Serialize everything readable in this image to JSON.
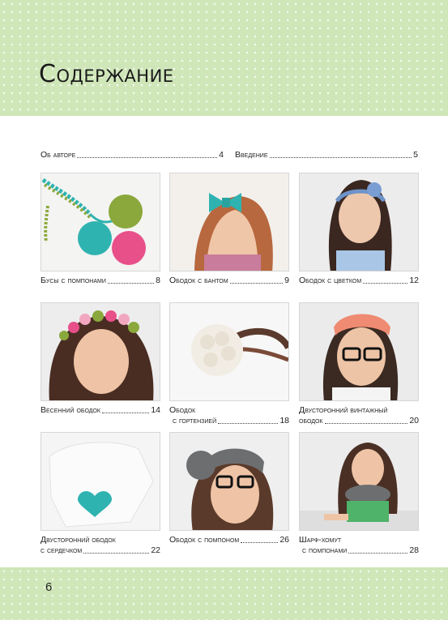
{
  "header": {
    "title": "Содержание"
  },
  "footer": {
    "page_number": "6"
  },
  "intro_entries": [
    {
      "label": "Об авторе",
      "page": "4"
    },
    {
      "label": "Введение",
      "page": "5"
    }
  ],
  "projects": [
    {
      "lines": [
        "Бусы с помпонами"
      ],
      "page": "8",
      "image": "pompom-necklace-photo"
    },
    {
      "lines": [
        "Ободок с бантом"
      ],
      "page": "9",
      "image": "bow-headband-photo"
    },
    {
      "lines": [
        "Ободок с цветком"
      ],
      "page": "12",
      "image": "flower-headband-photo"
    },
    {
      "lines": [
        "Весенний ободок"
      ],
      "page": "14",
      "image": "spring-wreath-headband-photo"
    },
    {
      "lines": [
        "Ободок",
        "с гортензией"
      ],
      "page": "18",
      "image": "hydrangea-headband-photo"
    },
    {
      "lines": [
        "Двусторонний винтажный",
        "ободок"
      ],
      "page": "20",
      "image": "vintage-headband-photo"
    },
    {
      "lines": [
        "Двусторонний ободок",
        "с сердечком"
      ],
      "page": "22",
      "image": "heart-headband-photo"
    },
    {
      "lines": [
        "Ободок с помпоном"
      ],
      "page": "26",
      "image": "pompom-headband-photo"
    },
    {
      "lines": [
        "Шарф-хомут",
        "с помпонами"
      ],
      "page": "28",
      "image": "cowl-scarf-photo"
    }
  ],
  "colors": {
    "band_green": "#cfe6b8",
    "teal_yarn": "#2fb3b0",
    "pink_yarn": "#e8508a",
    "olive_yarn": "#8aa83c",
    "grey_yarn": "#6d6e70",
    "coral_yarn": "#ef8b72"
  }
}
